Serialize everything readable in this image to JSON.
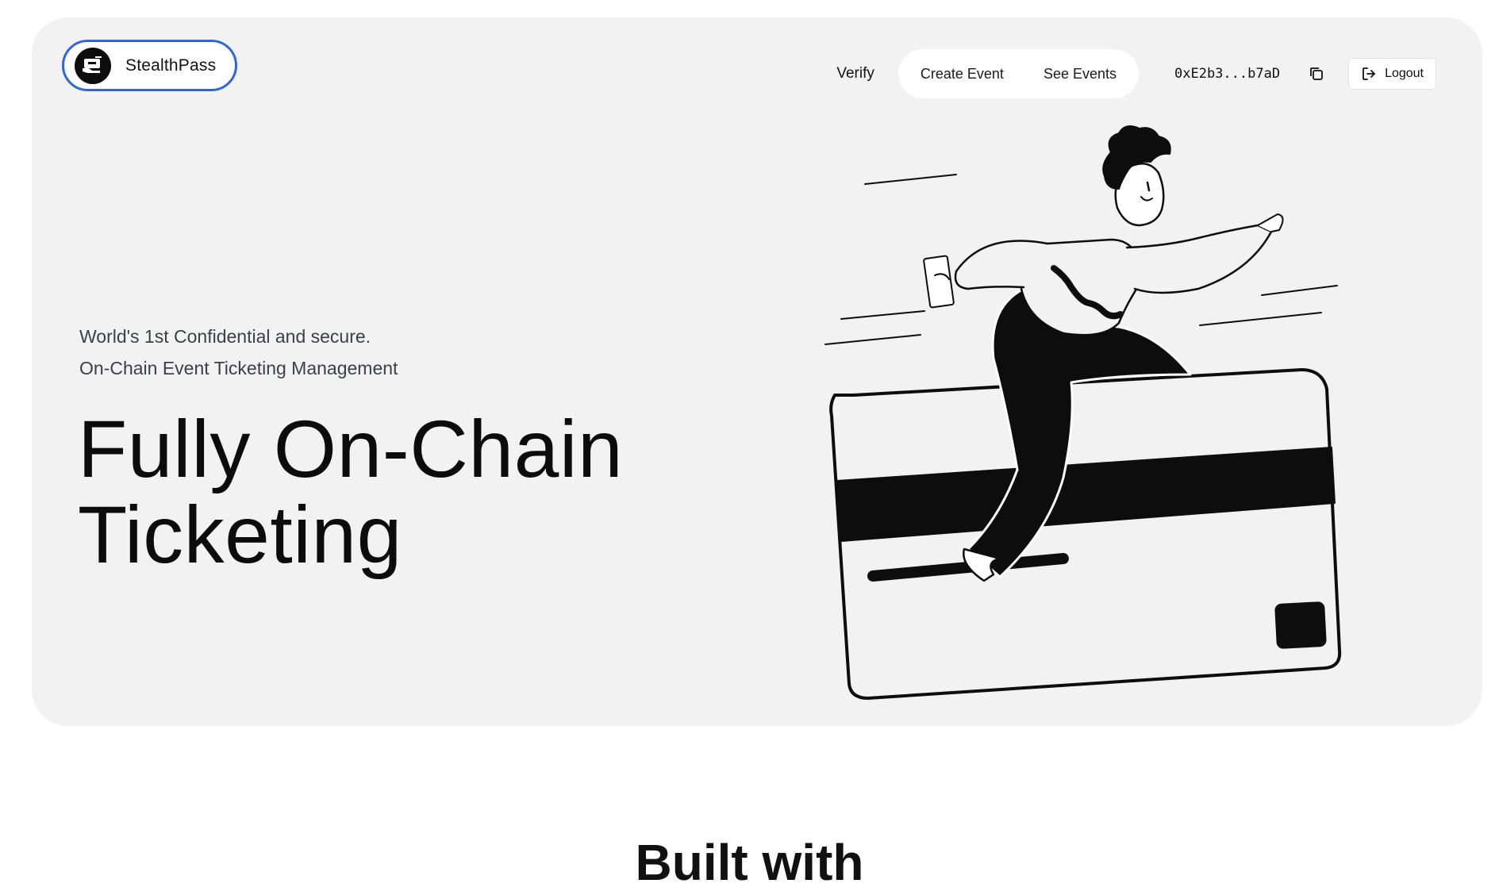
{
  "brand": {
    "name": "StealthPass",
    "logo_icon": "ticket-hand-icon"
  },
  "nav": {
    "verify": "Verify",
    "create_event": "Create Event",
    "see_events": "See Events",
    "wallet_address": "0xE2b3...b7aD",
    "copy_icon": "copy-icon",
    "logout": "Logout",
    "logout_icon": "logout-arrow-icon"
  },
  "hero": {
    "tagline_line1": "World's 1st Confidential and secure.",
    "tagline_line2": "On-Chain Event Ticketing Management",
    "headline_line1": "Fully On-Chain",
    "headline_line2": "Ticketing",
    "illustration": "person-jumping-over-card-illustration"
  },
  "next_section": {
    "title": "Built with"
  },
  "colors": {
    "hero_background": "#f2f2f2",
    "brand_border": "#2f66e0",
    "text_dark": "#111111",
    "tagline_text": "#3b3f4a"
  }
}
